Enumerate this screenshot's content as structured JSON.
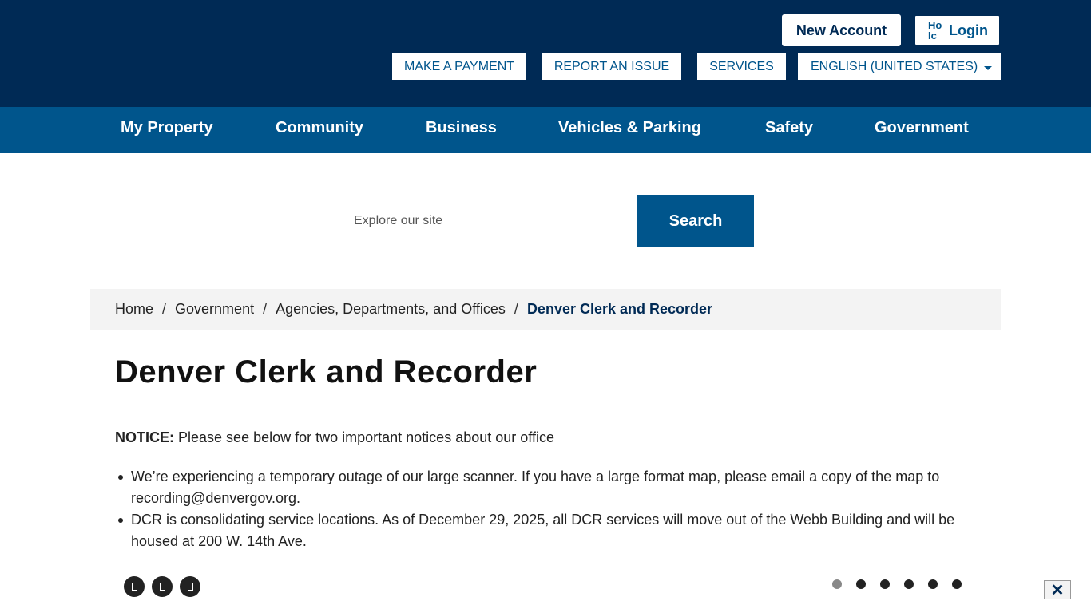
{
  "header": {
    "new_account_label": "New Account",
    "login_label": "Login",
    "login_icon_alt": "Ho Ic",
    "utility_links": [
      "MAKE A PAYMENT",
      "REPORT AN ISSUE",
      "SERVICES"
    ],
    "language_select": "ENGLISH (UNITED STATES)"
  },
  "nav": {
    "items": [
      "My Property",
      "Community",
      "Business",
      "Vehicles & Parking",
      "Safety",
      "Government"
    ]
  },
  "search": {
    "placeholder": "Explore our site",
    "button_label": "Search"
  },
  "breadcrumb": {
    "items": [
      "Home",
      "Government",
      "Agencies, Departments, and Offices"
    ],
    "separator": "/",
    "current": "Denver Clerk and Recorder"
  },
  "page": {
    "title": "Denver Clerk and Recorder",
    "notice_label": "NOTICE:",
    "notice_text": "Please see below for two important notices about our office",
    "bullets": [
      "We’re experiencing a temporary outage of our large scanner. If you have a large format map, please email a copy of the map to recording@denvergov.org.",
      "DCR is consolidating service locations. As of December 29, 2025, all DCR services will move out of the Webb Building and will be housed at 200 W. 14th Ave."
    ]
  },
  "carousel": {
    "controls": [
      "prev-icon",
      "pause-icon",
      "next-icon"
    ],
    "slide_count": 6,
    "active_slide": 1
  },
  "close_label": "✕",
  "colors": {
    "header_bg": "#002a55",
    "nav_bg": "#00558c",
    "breadcrumb_bg": "#f3f3f3"
  }
}
